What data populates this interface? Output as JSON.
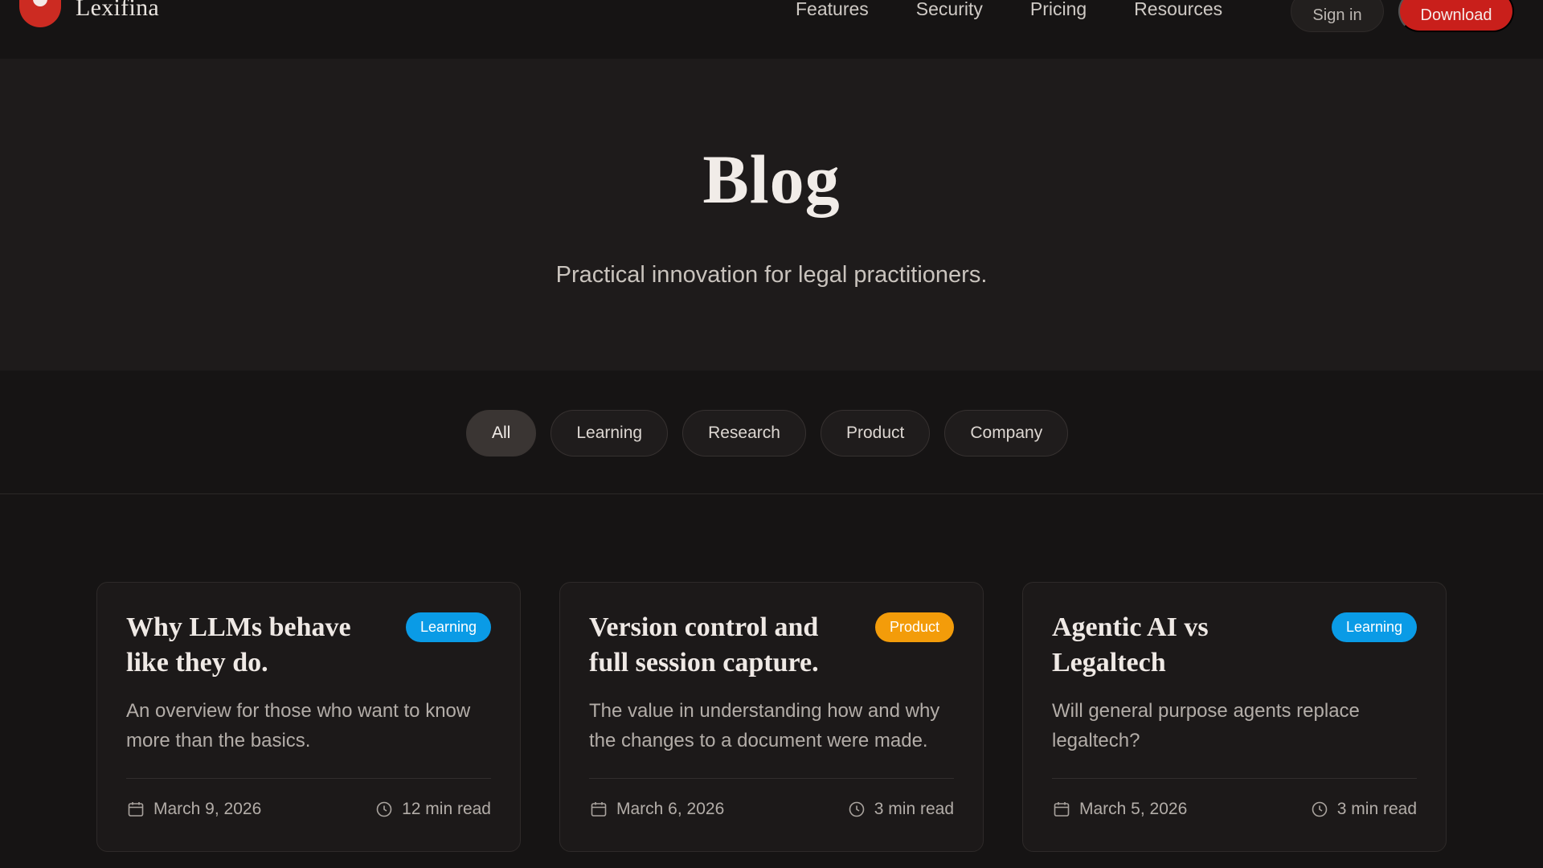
{
  "nav": {
    "brand": "Lexifina",
    "links": [
      "Features",
      "Security",
      "Pricing",
      "Resources"
    ],
    "signin": "Sign in",
    "download": "Download"
  },
  "hero": {
    "title": "Blog",
    "subtitle": "Practical innovation for legal practitioners."
  },
  "filters": [
    "All",
    "Learning",
    "Research",
    "Product",
    "Company"
  ],
  "active_filter": "All",
  "colors": {
    "accent": "#c91f1b",
    "learning_badge": "#0a9be6",
    "product_badge": "#f39c0a"
  },
  "posts": [
    {
      "title": "Why LLMs behave like they do.",
      "category": "Learning",
      "description": "An overview for those who want to know more than the basics.",
      "date": "March 9, 2026",
      "read_time": "12 min read"
    },
    {
      "title": "Version control and full session capture.",
      "category": "Product",
      "description": "The value in understanding how and why the changes to a document were made.",
      "date": "March 6, 2026",
      "read_time": "3 min read"
    },
    {
      "title": "Agentic AI vs Legaltech",
      "category": "Learning",
      "description": "Will general purpose agents replace legaltech?",
      "date": "March 5, 2026",
      "read_time": "3 min read"
    }
  ],
  "icons": {
    "date": "calendar-icon",
    "read_time": "clock-icon"
  }
}
